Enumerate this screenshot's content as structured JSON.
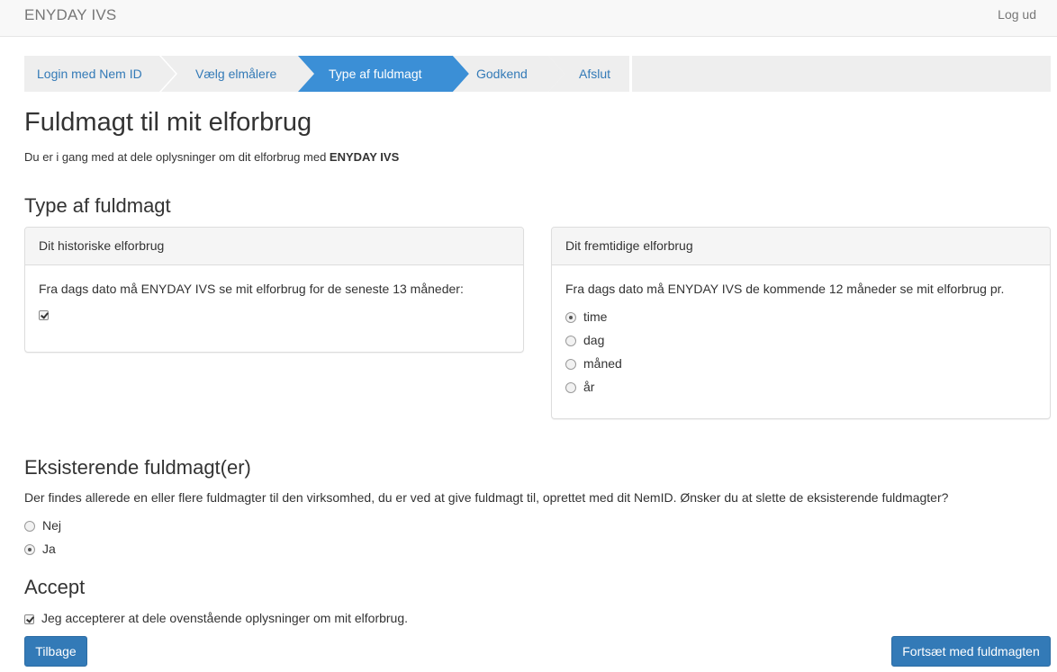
{
  "navbar": {
    "brand": "ENYDAY IVS",
    "logout": "Log ud"
  },
  "steps": [
    {
      "label": "Login med Nem ID",
      "state": "default"
    },
    {
      "label": "Vælg elmålere",
      "state": "default"
    },
    {
      "label": "Type af fuldmagt",
      "state": "active"
    },
    {
      "label": "Godkend",
      "state": "default"
    },
    {
      "label": "Afslut",
      "state": "default"
    }
  ],
  "colors": {
    "accent": "#337ab7",
    "step_bg": "#eeeeee",
    "step_active_bg": "#3b8fd6"
  },
  "page": {
    "title": "Fuldmagt til mit elforbrug",
    "intro_prefix": "Du er i gang med at dele oplysninger om dit elforbrug med ",
    "intro_company": "ENYDAY IVS"
  },
  "type_section": {
    "heading": "Type af fuldmagt",
    "historic": {
      "heading": "Dit historiske elforbrug",
      "text": "Fra dags dato må ENYDAY IVS se mit elforbrug for de seneste 13 måneder:",
      "checked": true
    },
    "future": {
      "heading": "Dit fremtidige elforbrug",
      "text": "Fra dags dato må ENYDAY IVS de kommende 12 måneder se mit elforbrug pr.",
      "options": [
        {
          "label": "time",
          "selected": true
        },
        {
          "label": "dag",
          "selected": false
        },
        {
          "label": "måned",
          "selected": false
        },
        {
          "label": "år",
          "selected": false
        }
      ]
    }
  },
  "existing_section": {
    "heading": "Eksisterende fuldmagt(er)",
    "text": "Der findes allerede en eller flere fuldmagter til den virksomhed, du er ved at give fuldmagt til, oprettet med dit NemID. Ønsker du at slette de eksisterende fuldmagter?",
    "options": [
      {
        "label": "Nej",
        "selected": false
      },
      {
        "label": "Ja",
        "selected": true
      }
    ]
  },
  "accept_section": {
    "heading": "Accept",
    "checkbox_label": "Jeg accepterer at dele ovenstående oplysninger om mit elforbrug.",
    "checked": true
  },
  "buttons": {
    "back": "Tilbage",
    "next": "Fortsæt med fuldmagten"
  }
}
